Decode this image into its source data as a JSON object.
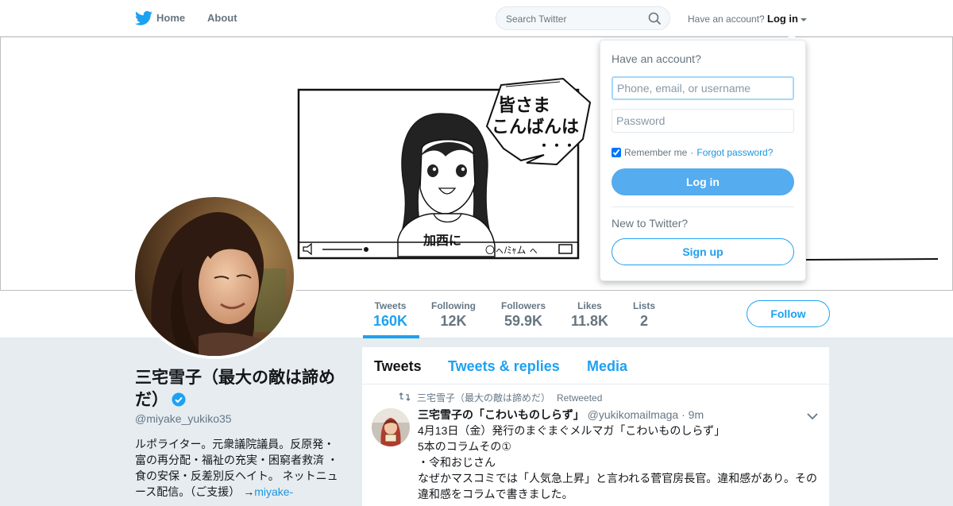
{
  "colors": {
    "brand": "#1da1f2",
    "login_button": "#55acee",
    "text_muted": "#657786"
  },
  "nav": {
    "home_label": "Home",
    "about_label": "About",
    "search_placeholder": "Search Twitter",
    "have_account_label": "Have an account?",
    "login_label": "Log in"
  },
  "banner": {
    "speech_line1": "皆さま",
    "speech_line2": "こんばんは",
    "speech_dots": "・・・",
    "shirt_text": "加西に",
    "player_text": "〇ㇸ/ﾐｬム ㇸ"
  },
  "stats": [
    {
      "label": "Tweets",
      "value": "160K"
    },
    {
      "label": "Following",
      "value": "12K"
    },
    {
      "label": "Followers",
      "value": "59.9K"
    },
    {
      "label": "Likes",
      "value": "11.8K"
    },
    {
      "label": "Lists",
      "value": "2"
    }
  ],
  "follow_label": "Follow",
  "profile": {
    "name_line1": "三宅雪子（最大の敵は諦め",
    "name_line2": "だ）",
    "handle": "@miyake_yukiko35",
    "bio_text": "ルポライター。元衆議院議員。反原発・富の再分配・福祉の充実・困窮者救済 ・食の安保・反差別反ヘイト。 ネットニュース配信。（ご支援） →",
    "bio_link": "miyake-"
  },
  "timeline": {
    "tabs": [
      "Tweets",
      "Tweets & replies",
      "Media"
    ],
    "tweet": {
      "retweeter": "三宅雪子（最大の敵は諦めだ）",
      "retweeted_label": "Retweeted",
      "author_name": "三宅雪子の「こわいものしらず」",
      "author_handle": "@yukikomailmaga",
      "time": "· 9m",
      "lines": [
        "4月13日（金）発行のまぐまぐメルマガ「こわいものしらず」",
        "5本のコラムその①",
        "・令和おじさん",
        "なぜかマスコミでは「人気急上昇」と言われる菅官房長官。違和感があり。その",
        "違和感をコラムで書きました。"
      ]
    }
  },
  "login_dropdown": {
    "title": "Have an account?",
    "username_placeholder": "Phone, email, or username",
    "password_placeholder": "Password",
    "remember_label": "Remember me",
    "separator": "·",
    "forgot_label": "Forgot password?",
    "login_button": "Log in",
    "new_label": "New to Twitter?",
    "signup_button": "Sign up"
  }
}
